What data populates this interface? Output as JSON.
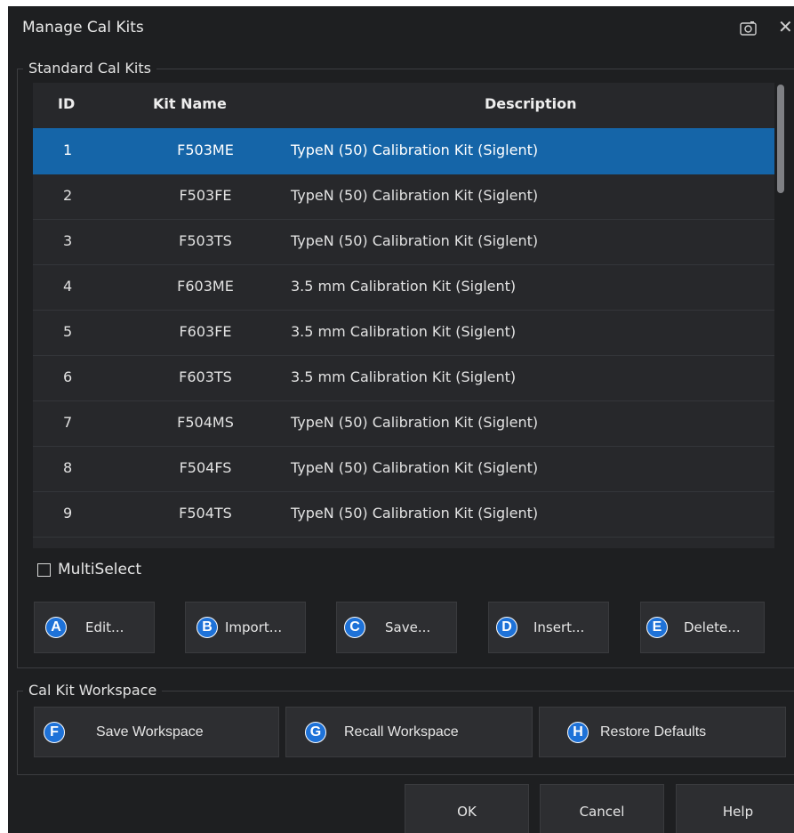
{
  "window": {
    "title": "Manage Cal Kits",
    "close_glyph": "✕"
  },
  "standard_group": {
    "title": "Standard Cal Kits"
  },
  "table": {
    "columns": [
      "ID",
      "Kit Name",
      "Description"
    ],
    "selected_row": 0,
    "rows": [
      {
        "id": "1",
        "name": "F503ME",
        "desc": "TypeN (50) Calibration Kit (Siglent)"
      },
      {
        "id": "2",
        "name": "F503FE",
        "desc": "TypeN (50) Calibration Kit (Siglent)"
      },
      {
        "id": "3",
        "name": "F503TS",
        "desc": "TypeN (50) Calibration Kit (Siglent)"
      },
      {
        "id": "4",
        "name": "F603ME",
        "desc": "3.5 mm Calibration Kit (Siglent)"
      },
      {
        "id": "5",
        "name": "F603FE",
        "desc": "3.5 mm Calibration Kit (Siglent)"
      },
      {
        "id": "6",
        "name": "F603TS",
        "desc": "3.5 mm Calibration Kit (Siglent)"
      },
      {
        "id": "7",
        "name": "F504MS",
        "desc": "TypeN (50) Calibration Kit (Siglent)"
      },
      {
        "id": "8",
        "name": "F504FS",
        "desc": "TypeN (50) Calibration Kit (Siglent)"
      },
      {
        "id": "9",
        "name": "F504TS",
        "desc": "TypeN (50) Calibration Kit (Siglent)"
      }
    ]
  },
  "multiselect": {
    "label": "MultiSelect",
    "checked": false
  },
  "kit_buttons": [
    {
      "marker": "A",
      "label": "Edit..."
    },
    {
      "marker": "B",
      "label": "Import..."
    },
    {
      "marker": "C",
      "label": "Save..."
    },
    {
      "marker": "D",
      "label": "Insert..."
    },
    {
      "marker": "E",
      "label": "Delete..."
    }
  ],
  "workspace_group": {
    "title": "Cal Kit Workspace"
  },
  "workspace_buttons": [
    {
      "marker": "F",
      "label": "Save Workspace"
    },
    {
      "marker": "G",
      "label": "Recall Workspace"
    },
    {
      "marker": "H",
      "label": "Restore Defaults"
    }
  ],
  "footer": {
    "ok": "OK",
    "cancel": "Cancel",
    "help": "Help"
  },
  "icons": {
    "camera": "camera-icon",
    "close": "close-icon",
    "checkbox": "checkbox-icon"
  },
  "colors": {
    "background": "#1e1f21",
    "selection": "#1565a8",
    "marker": "#1e72d8"
  }
}
